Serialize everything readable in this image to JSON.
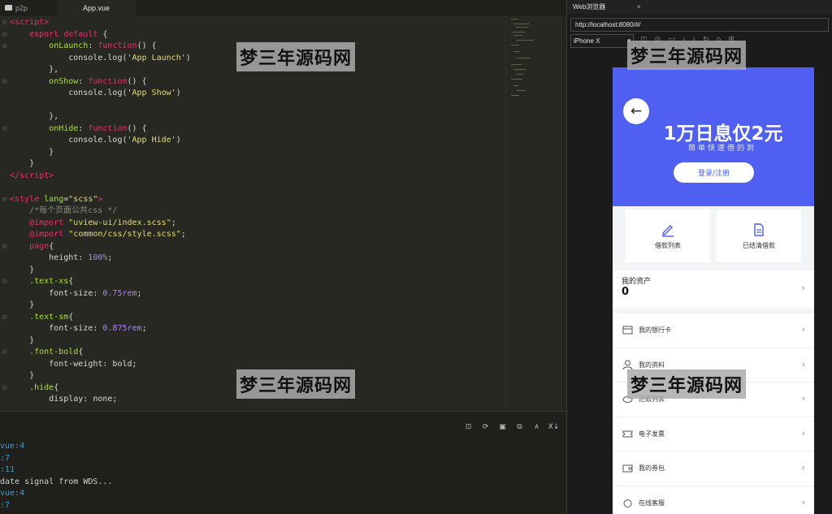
{
  "editor": {
    "tabs": [
      {
        "label": "p2p"
      },
      {
        "label": "App.vue"
      }
    ],
    "lines": [
      {
        "html": "<span class='tag'>&lt;script&gt;</span>",
        "fold": "⊟"
      },
      {
        "html": "    <span class='kw'>export default</span> {",
        "fold": "⊟"
      },
      {
        "html": "        <span class='fn'>onLaunch</span>: <span class='kw'>function</span>() {",
        "fold": "⊟"
      },
      {
        "html": "            console.log(<span class='str'>'App Launch'</span>)",
        "fold": ""
      },
      {
        "html": "        },",
        "fold": ""
      },
      {
        "html": "        <span class='fn'>onShow</span>: <span class='kw'>function</span>() {",
        "fold": "⊟"
      },
      {
        "html": "            console.log(<span class='str'>'App Show'</span>)",
        "fold": ""
      },
      {
        "html": "",
        "fold": ""
      },
      {
        "html": "        },",
        "fold": ""
      },
      {
        "html": "        <span class='fn'>onHide</span>: <span class='kw'>function</span>() {",
        "fold": "⊟"
      },
      {
        "html": "            console.log(<span class='str'>'App Hide'</span>)",
        "fold": ""
      },
      {
        "html": "        }",
        "fold": ""
      },
      {
        "html": "    }",
        "fold": ""
      },
      {
        "html": "<span class='tag'>&lt;/script&gt;</span>",
        "fold": ""
      },
      {
        "html": "",
        "fold": ""
      },
      {
        "html": "<span class='tag'>&lt;style</span> <span class='fn'>lang</span>=<span class='str'>\"scss\"</span><span class='tag'>&gt;</span>",
        "fold": "⊟"
      },
      {
        "html": "    <span class='cm'>/*每个页面公共css */</span>",
        "fold": ""
      },
      {
        "html": "    <span class='at'>@import</span> <span class='str'>\"uview-ui/index.scss\"</span>;",
        "fold": ""
      },
      {
        "html": "    <span class='at'>@import</span> <span class='str'>\"common/css/style.scss\"</span>;",
        "fold": ""
      },
      {
        "html": "    <span class='tag'>page</span>{",
        "fold": "⊟"
      },
      {
        "html": "        height: <span class='num'>100%</span>;",
        "fold": ""
      },
      {
        "html": "    }",
        "fold": ""
      },
      {
        "html": "    <span class='sel'>.text-xs</span>{",
        "fold": "⊟"
      },
      {
        "html": "        font-size: <span class='num'>0.75rem</span>;",
        "fold": ""
      },
      {
        "html": "    }",
        "fold": ""
      },
      {
        "html": "    <span class='sel'>.text-sm</span>{",
        "fold": "⊟"
      },
      {
        "html": "        font-size: <span class='num'>0.875rem</span>;",
        "fold": ""
      },
      {
        "html": "    }",
        "fold": ""
      },
      {
        "html": "    <span class='sel'>.font-bold</span>{",
        "fold": "⊟"
      },
      {
        "html": "        font-weight: bold;",
        "fold": ""
      },
      {
        "html": "    }",
        "fold": ""
      },
      {
        "html": "    <span class='sel'>.hide</span>{",
        "fold": "⊟"
      },
      {
        "html": "        display: none;",
        "fold": ""
      }
    ]
  },
  "console": {
    "lines": [
      {
        "text": "vue:4",
        "kind": "link"
      },
      {
        "text": ":7",
        "kind": "link"
      },
      {
        "text": ":11",
        "kind": "link"
      },
      {
        "text": "date signal from WDS...",
        "kind": "plain"
      },
      {
        "text": "vue:4",
        "kind": "link"
      },
      {
        "text": ":7",
        "kind": "link"
      }
    ]
  },
  "browser": {
    "tab_label": "Web浏览器",
    "tab_close": "×",
    "url": "http://localhost:8080/#/",
    "device": "iPhone X"
  },
  "app": {
    "back_icon": "←",
    "headline": "1万日息仅2元",
    "subline": "简单快速借的到",
    "login_button": "登录/注册",
    "cards": [
      {
        "label": "借款列表",
        "icon": "pen-icon"
      },
      {
        "label": "已结清借款",
        "icon": "document-icon"
      }
    ],
    "asset": {
      "label": "我的资产",
      "value": "0"
    },
    "menu": [
      {
        "label": "我的银行卡",
        "icon": "bank-card-icon"
      },
      {
        "label": "我的资料",
        "icon": "user-icon"
      },
      {
        "label": "还款列表",
        "icon": "hand-icon"
      },
      {
        "label": "电子发票",
        "icon": "ticket-icon"
      },
      {
        "label": "我的券包",
        "icon": "wallet-icon"
      },
      {
        "label": "在线客服",
        "icon": "support-icon"
      }
    ],
    "accent_color": "#4e5ff2"
  },
  "watermark": "梦三年源码网"
}
